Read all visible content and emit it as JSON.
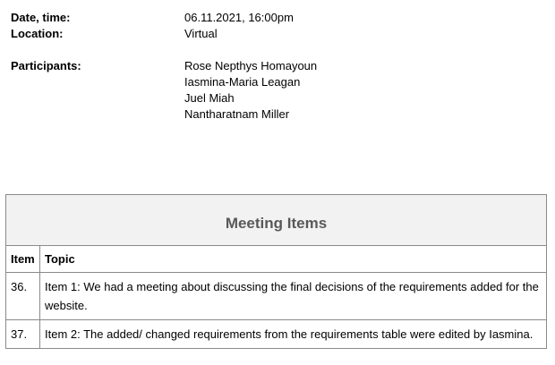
{
  "meta": {
    "date_label": "Date, time:",
    "date_value": "06.11.2021, 16:00pm",
    "location_label": "Location:",
    "location_value": "Virtual",
    "participants_label": "Participants:",
    "participants": [
      "Rose Nepthys Homayoun",
      "Iasmina-Maria Leagan",
      "Juel Miah",
      "Nantharatnam Miller"
    ]
  },
  "table": {
    "caption": "Meeting Items",
    "headers": [
      "Item",
      "Topic"
    ],
    "rows": [
      {
        "item": "36.",
        "topic": "Item 1: We had a meeting about discussing the final decisions of the requirements added for the website."
      },
      {
        "item": "37.",
        "topic": "Item 2: The added/ changed requirements from the requirements table were edited by Iasmina."
      }
    ]
  }
}
